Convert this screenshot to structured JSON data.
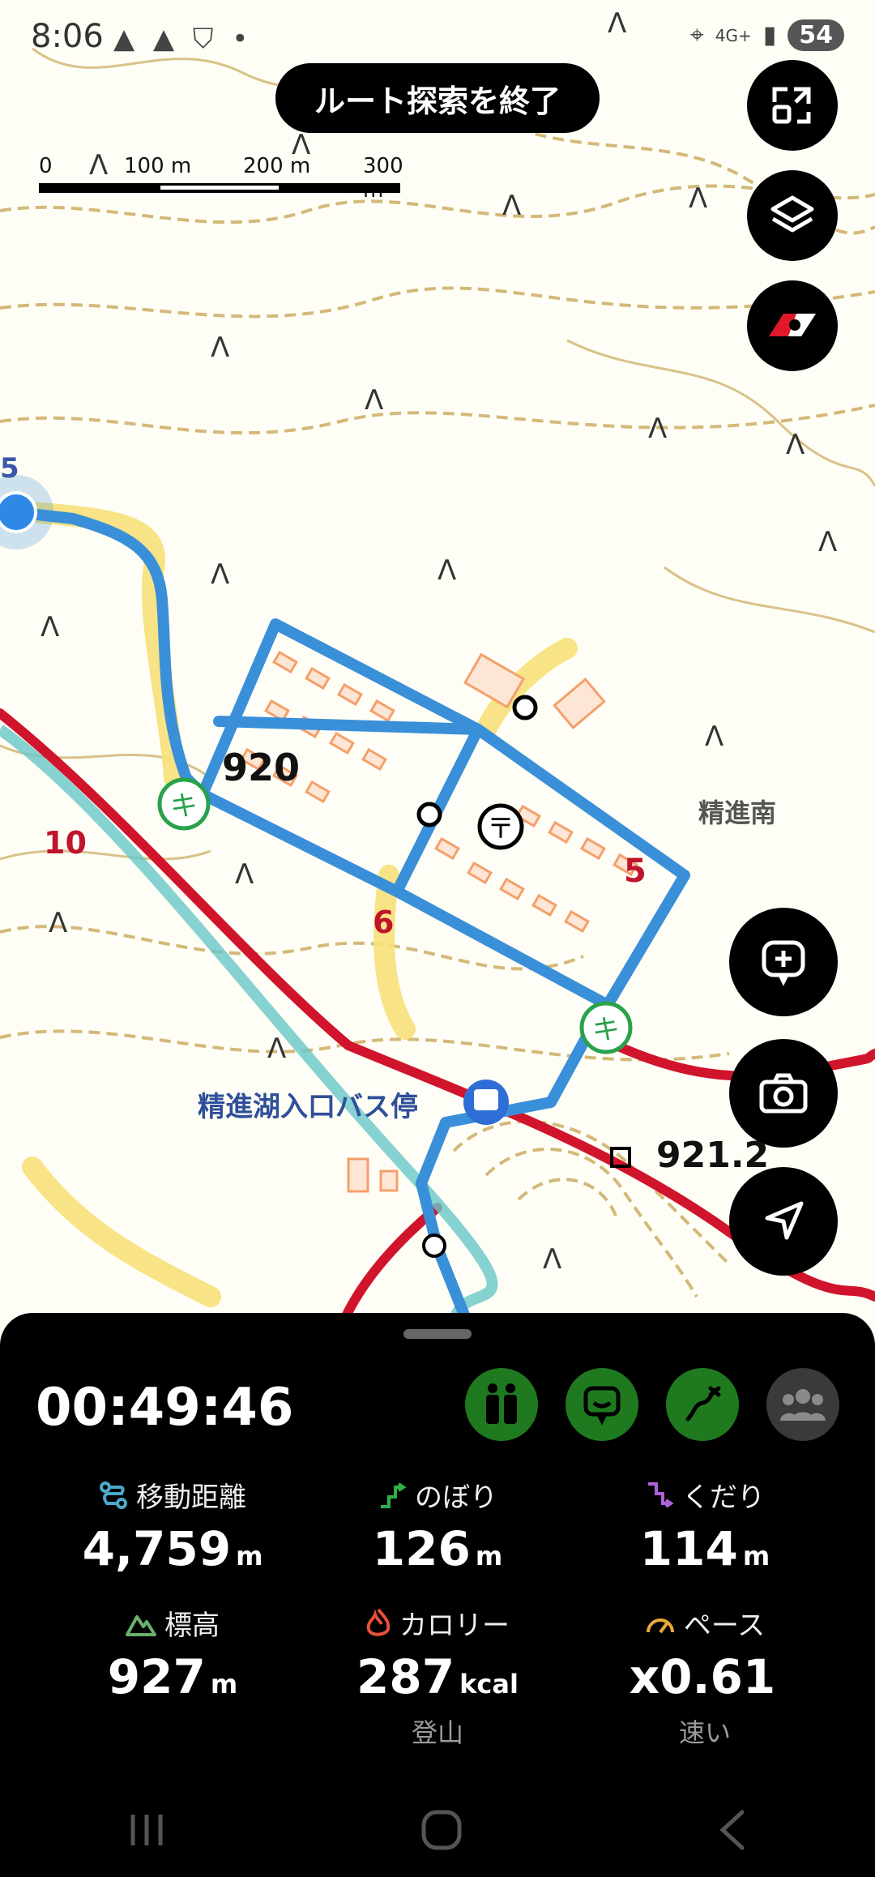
{
  "status_bar": {
    "time": "8:06",
    "left_icons": "▲ ▲ ⛉ •",
    "network": "4G+",
    "battery": "54"
  },
  "route": {
    "end_button": "ルート探索を終了"
  },
  "scale": {
    "labels": [
      "0",
      "100 m",
      "200 m",
      "300 m"
    ]
  },
  "map": {
    "labels": {
      "bus_stop": "精進湖入口バス停",
      "area": "精進南",
      "elevation_920": "920",
      "benchmark": "921.2",
      "road_10": "10",
      "road_6": "6",
      "road_5": "5",
      "marker_5": "5"
    }
  },
  "side_buttons": [
    "collapse-icon",
    "layers-icon",
    "compass-icon",
    "add-memo-icon",
    "camera-icon",
    "navigate-icon"
  ],
  "panel": {
    "timer": "00:49:46",
    "modes": [
      "hiking-mode-icon",
      "memo-mode-icon",
      "route-mode-icon",
      "group-icon"
    ],
    "stats": {
      "distance": {
        "label": "移動距離",
        "value": "4,759",
        "unit": "m"
      },
      "ascent": {
        "label": "のぼり",
        "value": "126",
        "unit": "m"
      },
      "descent": {
        "label": "くだり",
        "value": "114",
        "unit": "m"
      },
      "elevation": {
        "label": "標高",
        "value": "927",
        "unit": "m"
      },
      "calories": {
        "label": "カロリー",
        "value": "287",
        "unit": "kcal",
        "sub": "登山"
      },
      "pace": {
        "label": "ペース",
        "value": "x0.61",
        "unit": "",
        "sub": "速い"
      }
    }
  },
  "colors": {
    "route": "#3a8fd9",
    "road": "#d0142c",
    "accent_green": "#1f7a1f",
    "contour": "#c9a85a",
    "building": "#f4a06b"
  }
}
